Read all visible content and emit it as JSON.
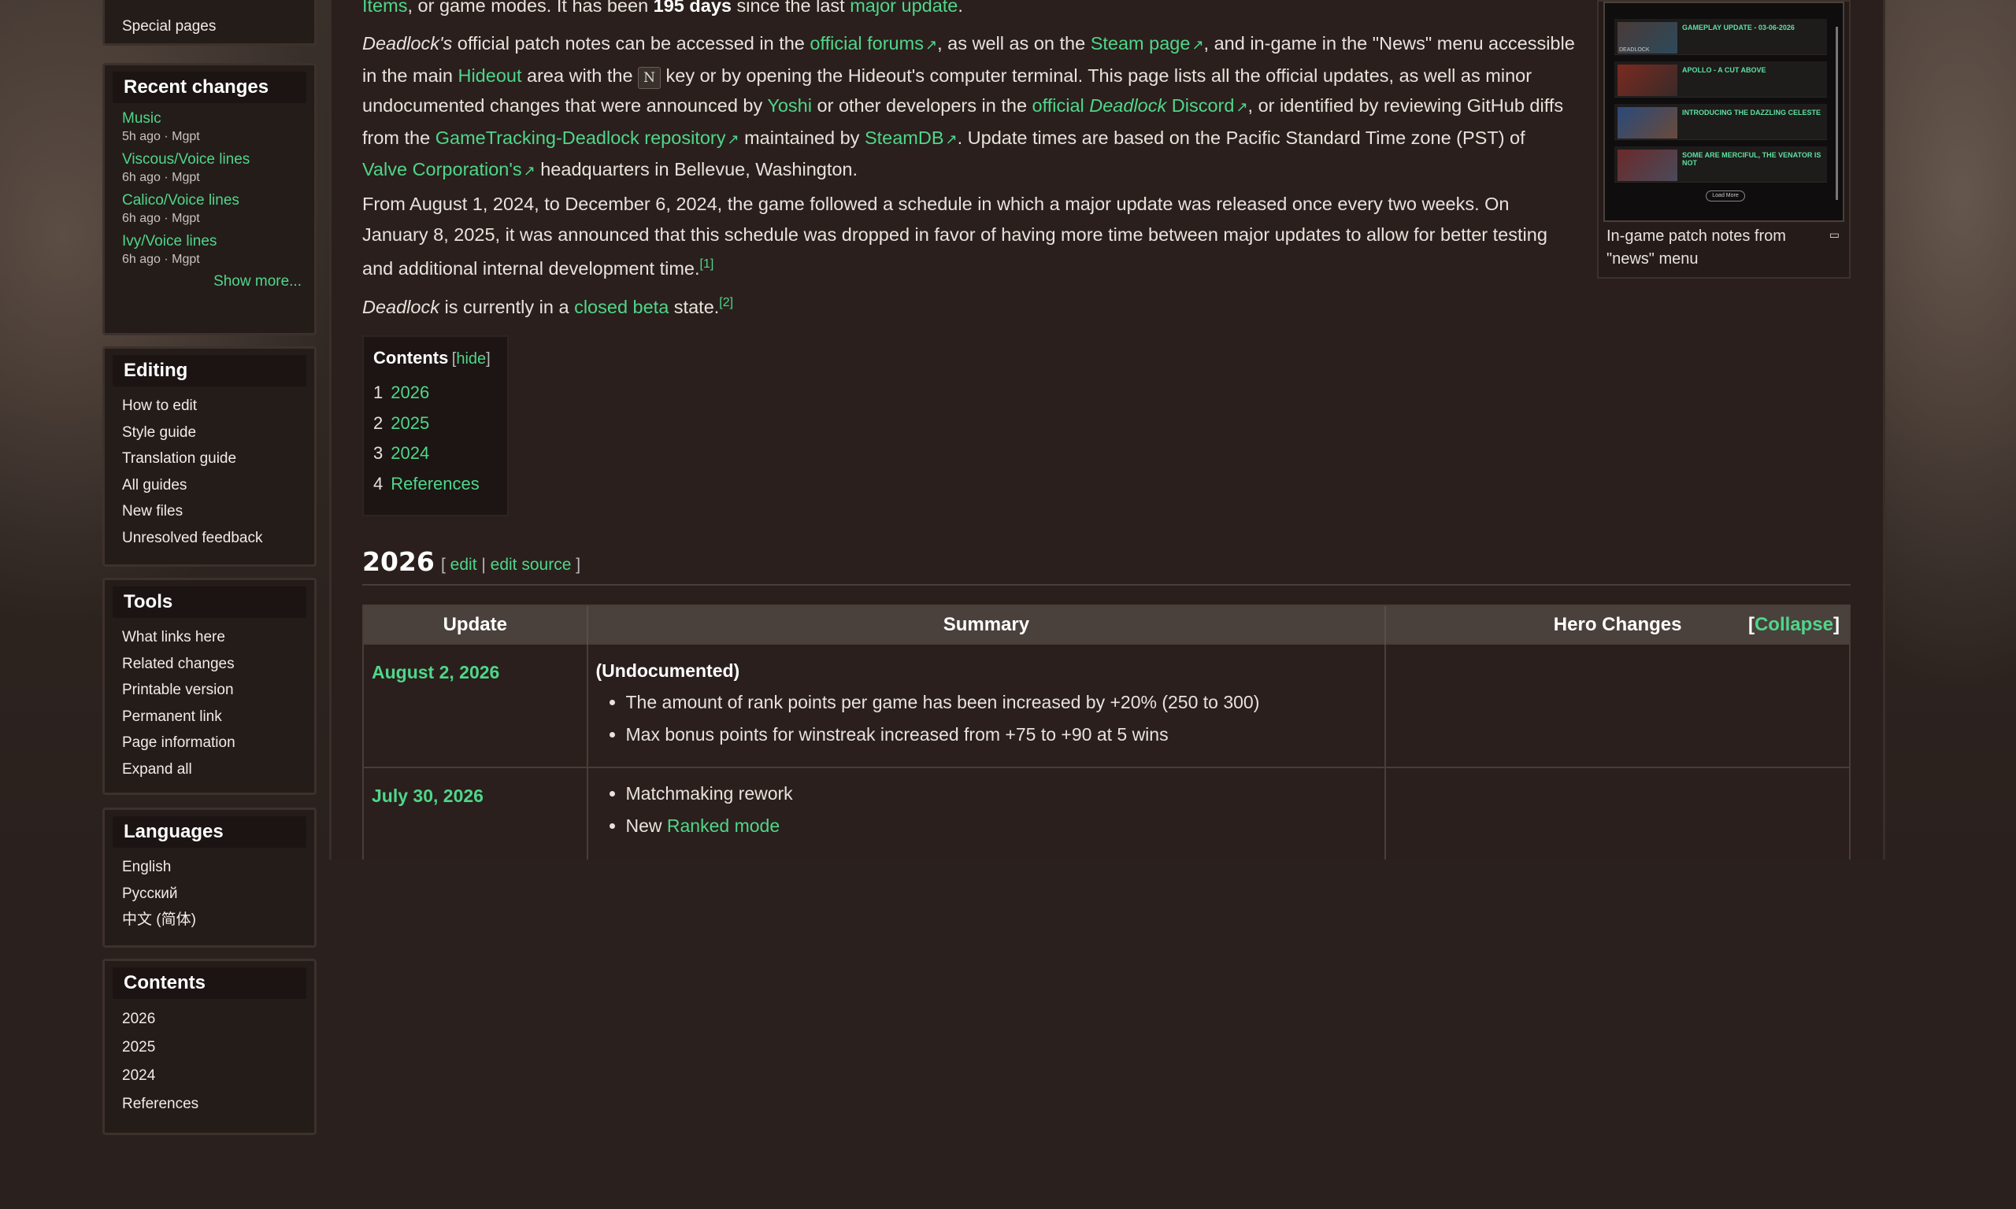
{
  "sidebar": {
    "top_item": "Special pages",
    "recent": {
      "title": "Recent changes",
      "items": [
        {
          "title": "Music",
          "meta": "5h ago · Mgpt"
        },
        {
          "title": "Viscous/Voice lines",
          "meta": "6h ago · Mgpt"
        },
        {
          "title": "Calico/Voice lines",
          "meta": "6h ago · Mgpt"
        },
        {
          "title": "Ivy/Voice lines",
          "meta": "6h ago · Mgpt"
        }
      ],
      "show_more": "Show more..."
    },
    "editing": {
      "title": "Editing",
      "items": [
        "How to edit",
        "Style guide",
        "Translation guide",
        "All guides",
        "New files",
        "Unresolved feedback"
      ]
    },
    "tools": {
      "title": "Tools",
      "items": [
        "What links here",
        "Related changes",
        "Printable version",
        "Permanent link",
        "Page information",
        "Expand all"
      ]
    },
    "languages": {
      "title": "Languages",
      "items": [
        "English",
        "Русский",
        "中文 (简体)"
      ]
    },
    "contents": {
      "title": "Contents",
      "items": [
        "2026",
        "2025",
        "2024",
        "References"
      ]
    }
  },
  "article": {
    "p0": {
      "a": "Items",
      "b": ", or game modes. It has been ",
      "days": "195 days",
      "c": " since the last ",
      "d": "major update",
      "e": "."
    },
    "p1": {
      "t1": "Deadlock's",
      "t2": " official patch notes can be accessed in the ",
      "l1": "official forums",
      "t3": ", as well as on the ",
      "l2": "Steam page",
      "t4": ", and in-game in the \"News\" menu accessible in the main ",
      "l3": "Hideout",
      "t5": " area with the ",
      "kbd": "N",
      "t6": " key or by opening the Hideout's computer terminal. This page lists all the official updates, as well as minor undocumented changes that were announced by ",
      "l4": "Yoshi",
      "t7": " or other developers in the ",
      "l5a": "official ",
      "l5b": "Deadlock",
      "l5c": " Discord",
      "t8": ", or identified by reviewing GitHub diffs from the ",
      "l6": "GameTracking-Deadlock repository",
      "t9": " maintained by ",
      "l7": "SteamDB",
      "t10": ". Update times are based on the Pacific Standard Time zone (PST) of ",
      "l8": "Valve Corporation's",
      "t11": " headquarters in Bellevue, Washington."
    },
    "p2": {
      "text": "From August 1, 2024, to December 6, 2024, the game followed a schedule in which a major update was released once every two weeks. On January 8, 2025, it was announced that this schedule was dropped in favor of having more time between major updates to allow for better testing and additional internal development time.",
      "ref": "[1]"
    },
    "p3": {
      "a": "Deadlock",
      "b": " is currently in a ",
      "link": "closed beta",
      "c": " state.",
      "ref": "[2]"
    }
  },
  "infobox": {
    "caption": "In-game patch notes from \"news\" menu",
    "rows": [
      "GAMEPLAY UPDATE - 03-06-2026",
      "APOLLO - A CUT ABOVE",
      "INTRODUCING THE DAZZLING CELESTE",
      "SOME ARE MERCIFUL, THE VENATOR IS NOT"
    ],
    "button": "Load More",
    "thumb_logo": "DEADLOCK"
  },
  "toc": {
    "title": "Contents",
    "hide_open": "[",
    "hide": "hide",
    "hide_close": "]",
    "items": [
      {
        "num": "1",
        "label": "2026"
      },
      {
        "num": "2",
        "label": "2025"
      },
      {
        "num": "3",
        "label": "2024"
      },
      {
        "num": "4",
        "label": "References"
      }
    ]
  },
  "section": {
    "title": "2026",
    "edit_open": "[ ",
    "edit": "edit",
    "sep": " | ",
    "edit_source": "edit source",
    "edit_close": " ]"
  },
  "table": {
    "headers": [
      "Update",
      "Summary",
      "Hero Changes"
    ],
    "collapse_open": "[",
    "collapse": "Collapse",
    "collapse_close": "]",
    "rows": [
      {
        "date": "August 2, 2026",
        "label": "(Undocumented)",
        "bullets": [
          "The amount of rank points per game has been increased by +20% (250 to 300)",
          "Max bonus points for winstreak increased from +75 to +90 at 5 wins"
        ]
      },
      {
        "date": "July 30, 2026",
        "bullet1": "Matchmaking rework",
        "bullet2_pre": "New ",
        "bullet2_link": "Ranked mode"
      }
    ]
  },
  "colors": {
    "link": "#4fd68a",
    "background": "#2a211e",
    "panel": "#2a1f1c"
  }
}
